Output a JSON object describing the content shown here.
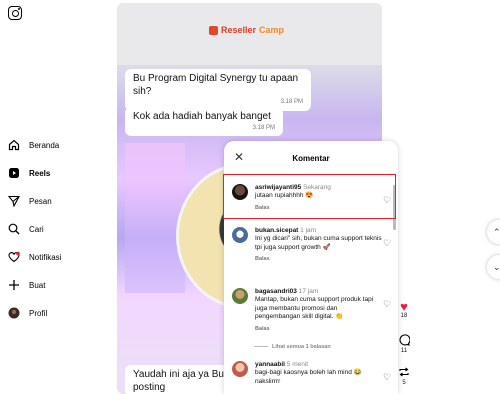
{
  "sidebar": {
    "items": [
      {
        "label": "Beranda",
        "icon": "home-icon"
      },
      {
        "label": "Reels",
        "icon": "reels-icon",
        "active": true
      },
      {
        "label": "Pesan",
        "icon": "send-icon"
      },
      {
        "label": "Cari",
        "icon": "search-icon"
      },
      {
        "label": "Notifikasi",
        "icon": "heart-icon"
      },
      {
        "label": "Buat",
        "icon": "plus-icon"
      },
      {
        "label": "Profil",
        "icon": "avatar-icon"
      }
    ]
  },
  "reel": {
    "brand_a": "Reseller",
    "brand_b": "Camp",
    "messages": [
      {
        "text": "Bu Program Digital Synergy tu apaan sih?",
        "time": "3.18 PM"
      },
      {
        "text": "Kok ada hadiah banyak banget",
        "time": "3.18 PM"
      },
      {
        "text": "Yaudah ini aja ya Bu posting",
        "time": ""
      }
    ]
  },
  "comments_panel": {
    "title": "Komentar",
    "reply_label": "Balas",
    "more_replies": "Lihat semua 1 balasan",
    "comments": [
      {
        "user": "asriwijayanti95",
        "time": "Sekarang",
        "text": "jutaan rupiahhhh 😍"
      },
      {
        "user": "bukan.sicepat",
        "time": "1 jam",
        "text": "Ini yg dicari\" sih, bukan cuma support teknis tpi juga support growth 🚀"
      },
      {
        "user": "bagasandri03",
        "time": "17 jam",
        "text": "Mantap, bukan cuma support produk tapi juga membantu promosi dan pengembangan skill digital. 👏"
      },
      {
        "user": "yannaabil",
        "time": "5 menit",
        "text": "bagi-bagi kaosnya boleh lah mind 😂 nakslirrrr"
      }
    ]
  },
  "actions": {
    "likes": "18",
    "comments": "11",
    "shares": "5"
  },
  "colors": {
    "highlight": "#e0202a",
    "like": "#ed1c3a"
  }
}
